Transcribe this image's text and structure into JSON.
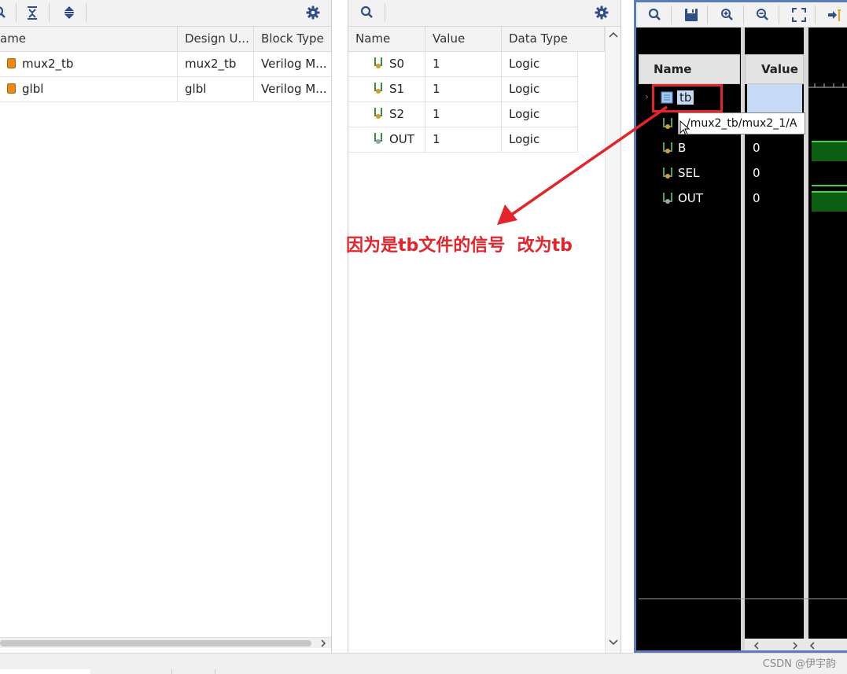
{
  "hierarchy_panel": {
    "columns": [
      "ame",
      "Design U...",
      "Block Type"
    ],
    "rows": [
      {
        "name": "mux2_tb",
        "design_unit": "mux2_tb",
        "block_type": "Verilog M..."
      },
      {
        "name": "glbl",
        "design_unit": "glbl",
        "block_type": "Verilog M..."
      }
    ]
  },
  "objects_panel": {
    "columns": [
      "Name",
      "Value",
      "Data Type"
    ],
    "rows": [
      {
        "name": "S0",
        "value": "1",
        "type": "Logic"
      },
      {
        "name": "S1",
        "value": "1",
        "type": "Logic"
      },
      {
        "name": "S2",
        "value": "1",
        "type": "Logic"
      },
      {
        "name": "OUT",
        "value": "1",
        "type": "Logic"
      }
    ]
  },
  "wave_panel": {
    "columns": [
      "Name",
      "Value"
    ],
    "rows": [
      {
        "name": "tb",
        "value": ""
      },
      {
        "name": "B",
        "value": "0"
      },
      {
        "name": "SEL",
        "value": "0"
      },
      {
        "name": "OUT",
        "value": "0"
      }
    ],
    "tooltip": "/mux2_tb/mux2_1/A"
  },
  "annotation": {
    "text": "因为是tb文件的信号  改为tb",
    "color": "#e3242b"
  },
  "watermark": "CSDN @伊宇韵",
  "colors": {
    "wave_bg": "#000000",
    "wave_green": "#0b5e12",
    "selection": "#c6daf5",
    "panel_border": "#5a7fb8"
  },
  "icons": [
    "search-icon",
    "collapse-all-icon",
    "expand-all-icon",
    "gear-icon",
    "save-icon",
    "zoom-in-icon",
    "zoom-out-icon",
    "zoom-fit-icon",
    "go-to-cursor-icon"
  ]
}
